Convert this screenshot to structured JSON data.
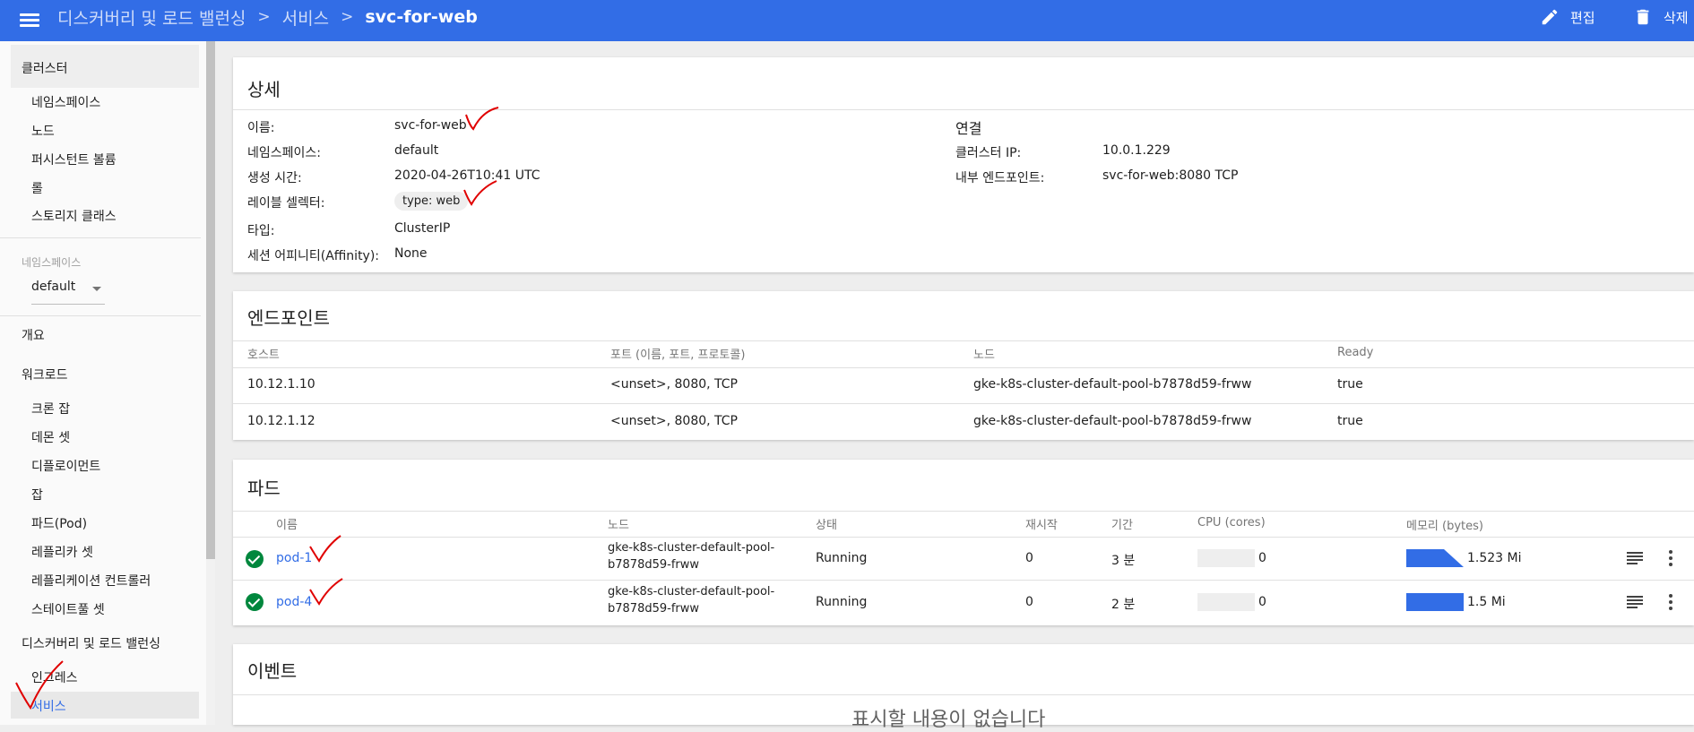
{
  "topbar": {
    "breadcrumbs": [
      "디스커버리 및 로드 밸런싱",
      "서비스"
    ],
    "current": "svc-for-web",
    "edit_label": "편집",
    "delete_label": "삭제"
  },
  "sidebar": {
    "cluster_header": "클러스터",
    "cluster_items": [
      "네임스페이스",
      "노드",
      "퍼시스턴트 볼륨",
      "롤",
      "스토리지 클래스"
    ],
    "namespace_label": "네임스페이스",
    "namespace_value": "default",
    "overview": "개요",
    "workloads_header": "워크로드",
    "workload_items": [
      "크론 잡",
      "데몬 셋",
      "디플로이먼트",
      "잡",
      "파드(Pod)",
      "레플리카 셋",
      "레플리케이션 컨트롤러",
      "스테이트풀 셋"
    ],
    "discovery_header": "디스커버리 및 로드 밸런싱",
    "discovery_items": [
      "인그레스",
      "서비스"
    ]
  },
  "details": {
    "title": "상세",
    "left": [
      {
        "key": "이름:",
        "value": "svc-for-web"
      },
      {
        "key": "네임스페이스:",
        "value": "default"
      },
      {
        "key": "생성 시간:",
        "value": "2020-04-26T10:41 UTC"
      },
      {
        "key": "레이블 셀렉터:",
        "value": "type: web"
      },
      {
        "key": "타입:",
        "value": "ClusterIP"
      },
      {
        "key": "세션 어피니티(Affinity):",
        "value": "None"
      }
    ],
    "connection_title": "연결",
    "right": [
      {
        "key": "클러스터 IP:",
        "value": "10.0.1.229"
      },
      {
        "key": "내부 엔드포인트:",
        "value": "svc-for-web:8080 TCP"
      }
    ]
  },
  "endpoints": {
    "title": "엔드포인트",
    "headers": [
      "호스트",
      "포트 (이름, 포트, 프로토콜)",
      "노드",
      "Ready"
    ],
    "rows": [
      [
        "10.12.1.10",
        "<unset>, 8080, TCP",
        "gke-k8s-cluster-default-pool-b7878d59-frww",
        "true"
      ],
      [
        "10.12.1.12",
        "<unset>, 8080, TCP",
        "gke-k8s-cluster-default-pool-b7878d59-frww",
        "true"
      ]
    ]
  },
  "pods": {
    "title": "파드",
    "headers": [
      "이름",
      "노드",
      "상태",
      "재시작",
      "기간",
      "CPU (cores)",
      "메모리 (bytes)"
    ],
    "rows": [
      {
        "name": "pod-1",
        "node_line1": "gke-k8s-cluster-default-pool-",
        "node_line2": "b7878d59-frww",
        "status": "Running",
        "restarts": "0",
        "age": "3 분",
        "cpu": "0",
        "memory": "1.523 Mi"
      },
      {
        "name": "pod-4",
        "node_line1": "gke-k8s-cluster-default-pool-",
        "node_line2": "b7878d59-frww",
        "status": "Running",
        "restarts": "0",
        "age": "2 분",
        "cpu": "0",
        "memory": "1.5 Mi"
      }
    ]
  },
  "events": {
    "title": "이벤트",
    "empty": "표시할 내용이 없습니다"
  },
  "colors": {
    "brand": "#326de6",
    "ok": "#00873d",
    "annotation": "#e00000"
  }
}
